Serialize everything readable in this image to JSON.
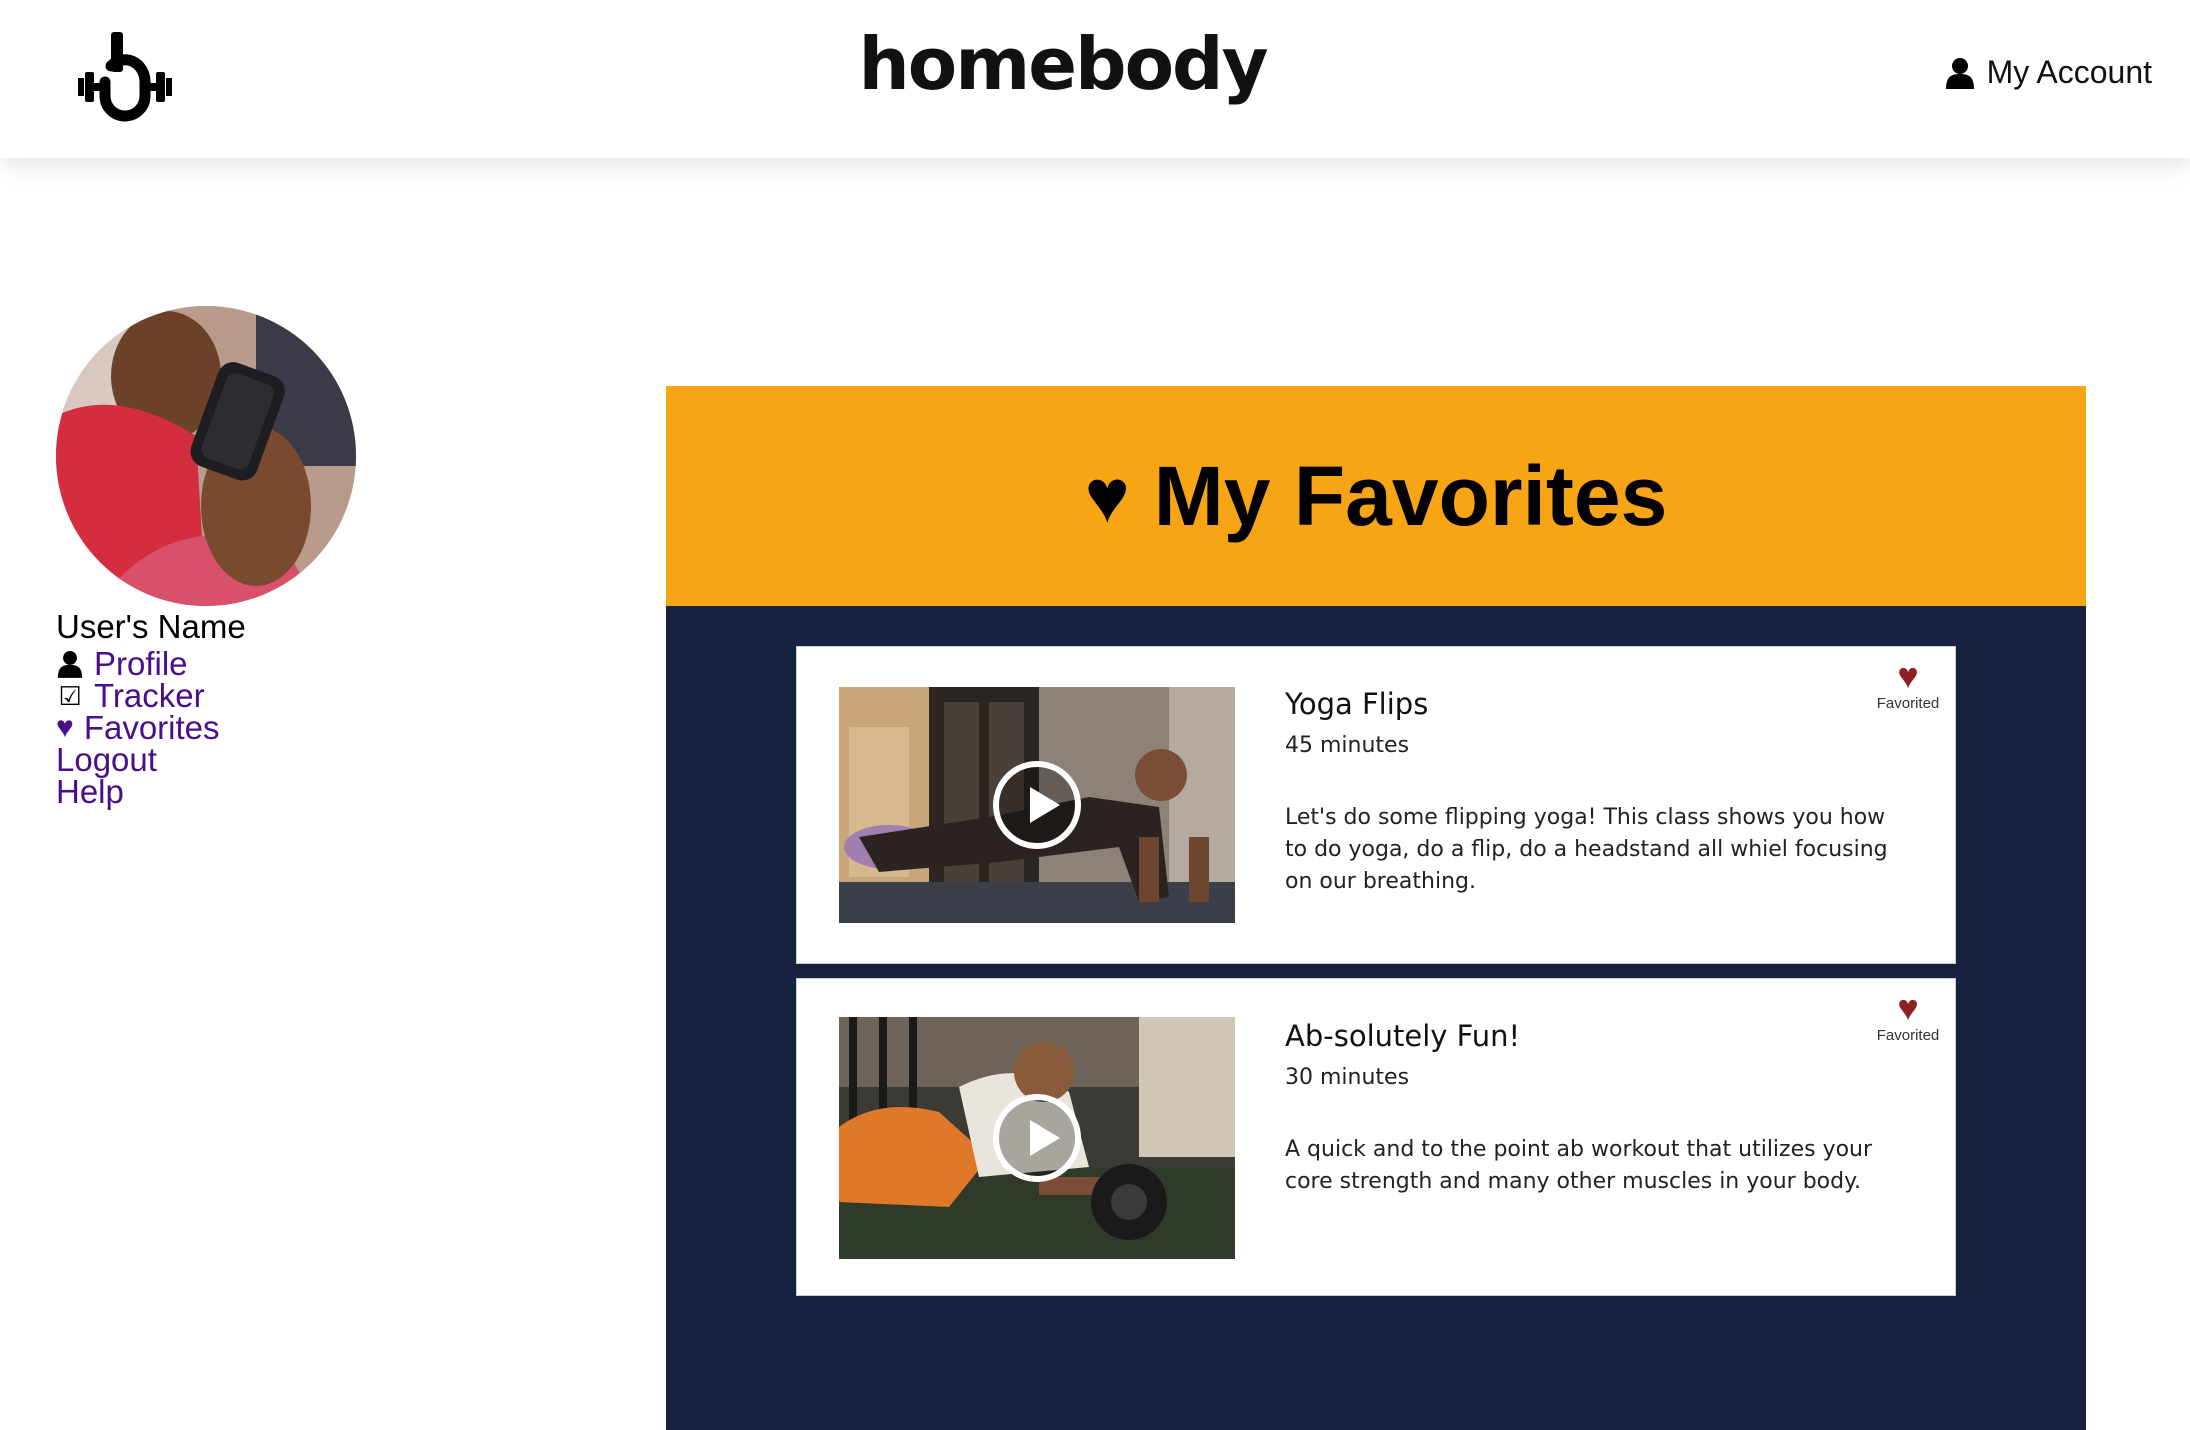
{
  "header": {
    "brand": "homebody",
    "account_label": "My Account",
    "logo_icon": "barbell-b-logo",
    "account_icon": "user-icon"
  },
  "sidebar": {
    "user_name": "User's Name",
    "links": [
      {
        "icon": "user-icon",
        "glyph": "",
        "label": "Profile"
      },
      {
        "icon": "checkbox-icon",
        "glyph": "☑",
        "label": "Tracker"
      },
      {
        "icon": "heart-icon",
        "glyph": "♥",
        "label": "Favorites"
      },
      {
        "icon": "",
        "glyph": "",
        "label": "Logout"
      },
      {
        "icon": "",
        "glyph": "",
        "label": "Help"
      }
    ],
    "link_color": "#4b0e8a"
  },
  "favorites": {
    "heading_icon": "♥",
    "heading": "My Favorites",
    "header_color": "#f8a515",
    "panel_color": "#172140",
    "cards": [
      {
        "title": "Yoga Flips",
        "duration": "45 minutes",
        "description": "Let's do some flipping yoga! This class shows you how to do yoga, do a flip, do a headstand all whiel focusing on our breathing.",
        "fav_icon": "♥",
        "fav_label": "Favorited"
      },
      {
        "title": "Ab-solutely Fun!",
        "duration": "30 minutes",
        "description": "A quick and to the point ab workout that utilizes your core strength and many other muscles in your body.",
        "fav_icon": "♥",
        "fav_label": "Favorited"
      }
    ]
  }
}
